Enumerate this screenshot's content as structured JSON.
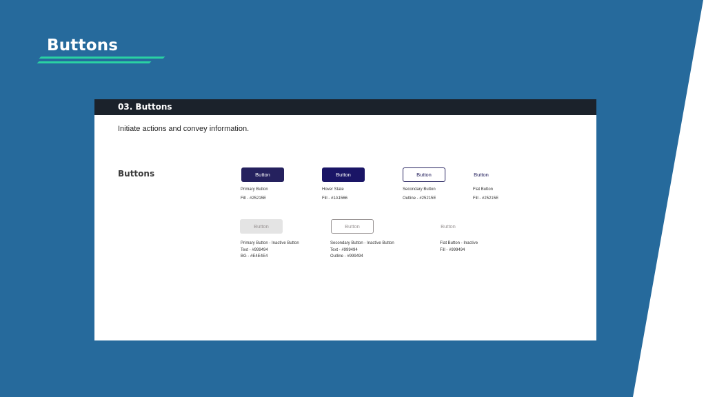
{
  "slide": {
    "title": "Buttons",
    "colors": {
      "background": "#266a9c",
      "accent": "#2ad1a3"
    }
  },
  "card": {
    "header_title": "03. Buttons",
    "description": "Initiate actions and convey information.",
    "section_heading": "Buttons"
  },
  "buttons": {
    "primary": {
      "label": "Button",
      "name": "Primary Button",
      "spec1": "Fill - #25215E"
    },
    "hover": {
      "label": "Button",
      "name": "Hover State",
      "spec1": "Fill - #1A1566"
    },
    "secondary": {
      "label": "Button",
      "name": "Secondary Button",
      "spec1": "Outline - #25215E"
    },
    "flat": {
      "label": "Button",
      "name": "Flat Button",
      "spec1": "Fill - #25215E"
    },
    "primary_inactive": {
      "label": "Button",
      "name": "Primary Button - Inactive Button",
      "spec1": "Text - #999494",
      "spec2": "BG - #E4E4E4"
    },
    "secondary_inactive": {
      "label": "Button",
      "name": "Secondary Button - Inactive Button",
      "spec1": "Text - #999494",
      "spec2": "Outline - #999494"
    },
    "flat_inactive": {
      "label": "Button",
      "name": "Flat Button - Inactive",
      "spec1": "Fill - #999494"
    }
  }
}
